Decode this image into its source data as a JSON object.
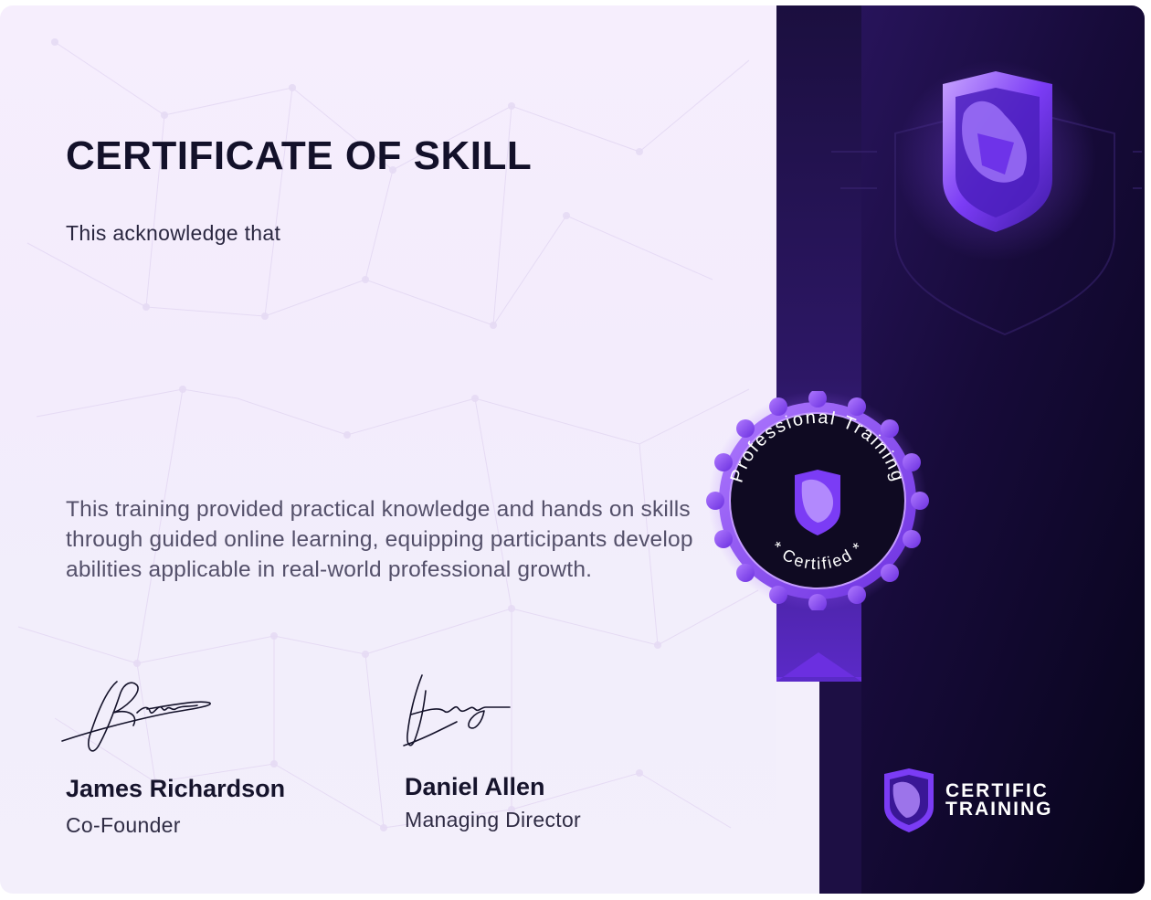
{
  "certificate": {
    "title": "CERTIFICATE OF SKILL",
    "acknowledge": "This acknowledge that",
    "description": "This training provided practical knowledge and hands on skills through guided online learning, equipping participants develop abilities applicable in real-world professional growth."
  },
  "signatories": [
    {
      "name": "James Richardson",
      "role": "Co-Founder"
    },
    {
      "name": "Daniel Allen",
      "role": "Managing Director"
    }
  ],
  "seal": {
    "top_text": "Professional Training",
    "bottom_text": "* Certified *"
  },
  "brand": {
    "line1": "CERTIFIC",
    "line2": "TRAINING"
  },
  "colors": {
    "accent": "#7b3cf5",
    "dark_panel": "#120a2b",
    "ribbon": "#6b2fe0"
  },
  "icons": [
    "network-pattern",
    "shield-fox-icon",
    "circuit-shield-watermark",
    "badge-seal"
  ]
}
